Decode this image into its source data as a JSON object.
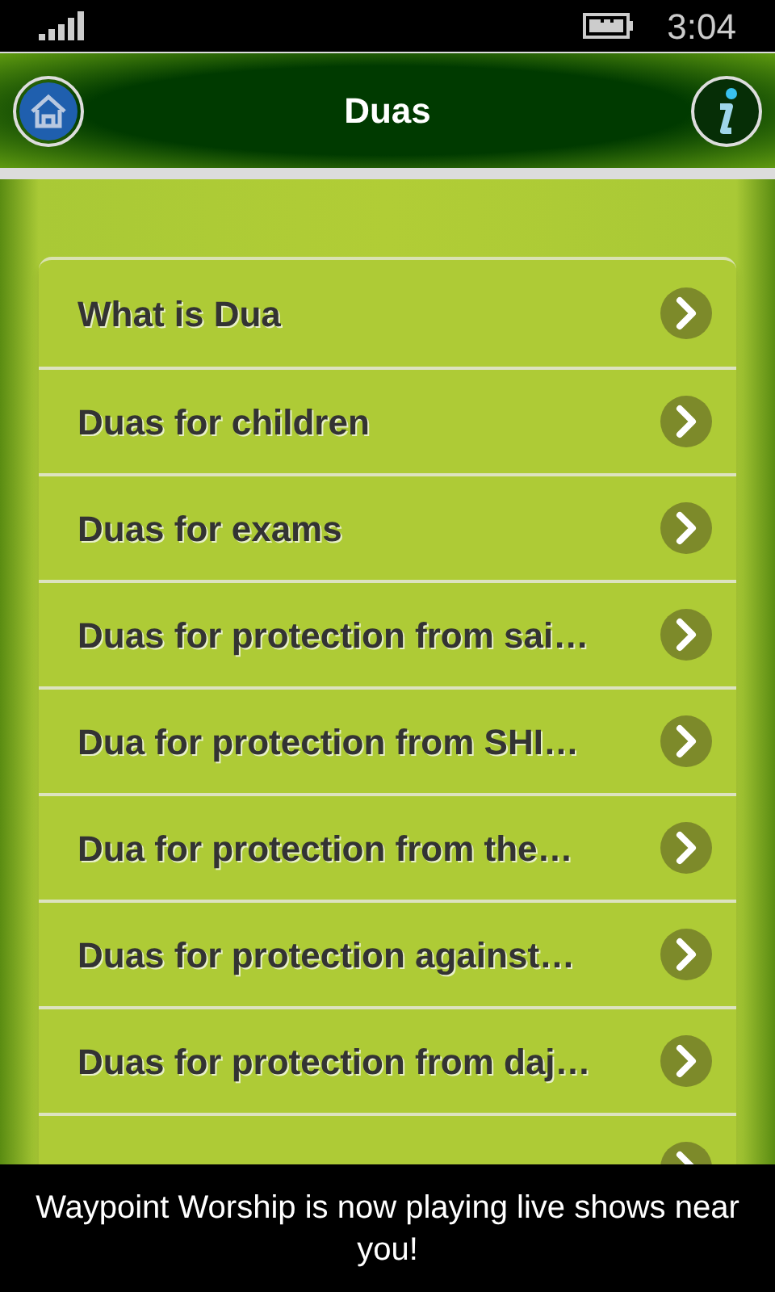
{
  "status_bar": {
    "time": "3:04"
  },
  "header": {
    "title": "Duas"
  },
  "items": [
    {
      "label": "What is Dua"
    },
    {
      "label": "Duas for children"
    },
    {
      "label": "Duas for exams"
    },
    {
      "label": "Duas for protection from sai…"
    },
    {
      "label": "Dua for protection from SHI…"
    },
    {
      "label": "Dua for protection from the…"
    },
    {
      "label": "Duas for protection against…"
    },
    {
      "label": "Duas for protection from daj…"
    },
    {
      "kind": "covered"
    }
  ],
  "toast": {
    "message": "Waypoint Worship is now playing live shows near you!"
  }
}
